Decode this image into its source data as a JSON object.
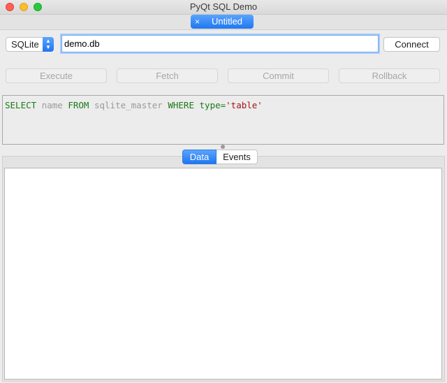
{
  "window": {
    "title": "PyQt SQL Demo"
  },
  "tabs": [
    {
      "label": "Untitled",
      "close_icon": "×"
    }
  ],
  "connection": {
    "driver": "SQLite",
    "database": "demo.db",
    "connect_label": "Connect"
  },
  "actions": {
    "execute": "Execute",
    "fetch": "Fetch",
    "commit": "Commit",
    "rollback": "Rollback"
  },
  "query": {
    "kw_select": "SELECT",
    "col_name": "name",
    "kw_from": "FROM",
    "table": "sqlite_master",
    "kw_where": "WHERE",
    "col_type": "type",
    "op": "=",
    "str_value": "'table'"
  },
  "result_tabs": {
    "data": "Data",
    "events": "Events"
  },
  "colors": {
    "accent": "#1f77ef",
    "keyword": "#1a7a1a",
    "string": "#a31515",
    "identifier": "#9a9a9a"
  }
}
